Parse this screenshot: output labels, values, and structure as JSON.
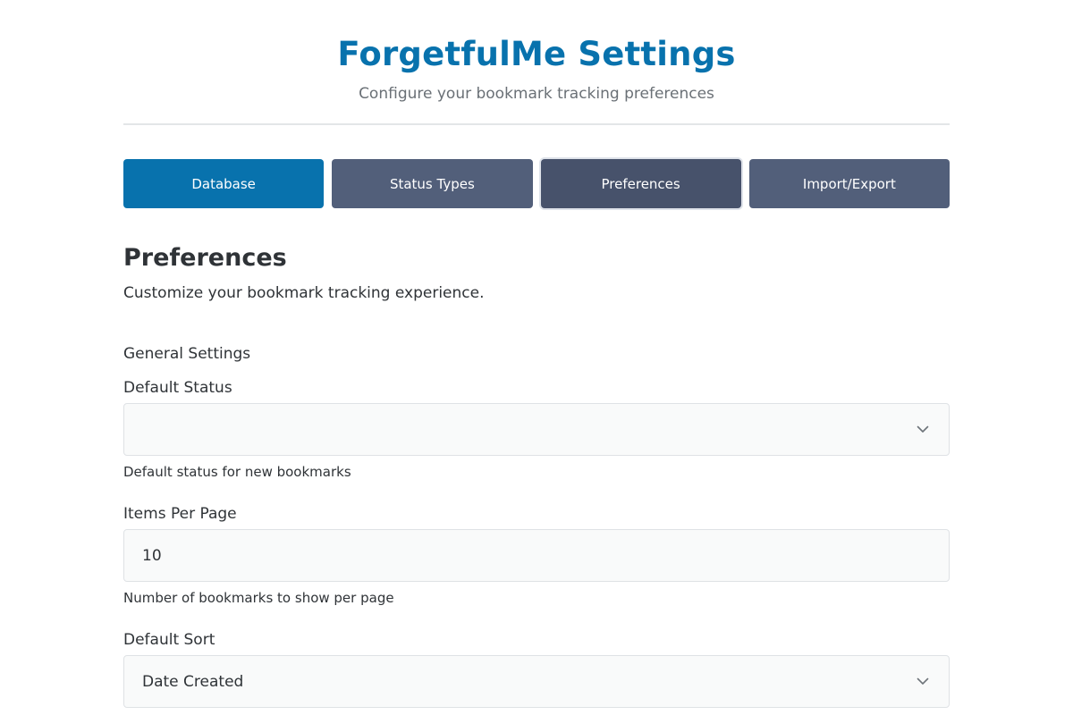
{
  "header": {
    "title": "ForgetfulMe Settings",
    "subtitle": "Configure your bookmark tracking preferences"
  },
  "tabs": [
    {
      "label": "Database",
      "state": "active"
    },
    {
      "label": "Status Types",
      "state": "default"
    },
    {
      "label": "Preferences",
      "state": "hover"
    },
    {
      "label": "Import/Export",
      "state": "default"
    }
  ],
  "section": {
    "title": "Preferences",
    "description": "Customize your bookmark tracking experience."
  },
  "general": {
    "group_title": "General Settings",
    "default_status": {
      "label": "Default Status",
      "value": "",
      "help": "Default status for new bookmarks",
      "icon": "chevron-down-icon"
    },
    "items_per_page": {
      "label": "Items Per Page",
      "value": "10",
      "help": "Number of bookmarks to show per page"
    },
    "default_sort": {
      "label": "Default Sort",
      "value": "Date Created",
      "icon": "chevron-down-icon"
    }
  },
  "colors": {
    "accent": "#0872ad",
    "tab_default": "#525f7a",
    "tab_hover": "#47526b",
    "input_bg": "#f9fafa",
    "border": "#dfe2e5"
  }
}
